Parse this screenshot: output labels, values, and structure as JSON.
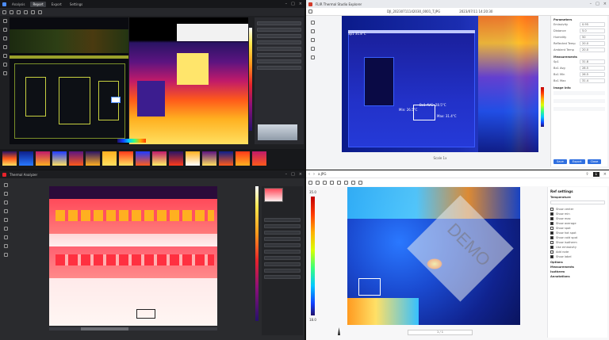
{
  "q1": {
    "tabs": [
      "Analysis",
      "Report",
      "Export",
      "Settings"
    ],
    "active_tab": 1,
    "colors": {
      "bg": "#1e1f22",
      "accent": "#4c8dff"
    }
  },
  "q2": {
    "toolbar_title": "FLIR Thermal Studio Explorer",
    "file_name": "DJI_20230711142030_0001_T.JPG",
    "timestamp": "2023/07/11 14:20:30",
    "labels": {
      "box_name": "Bx1",
      "avg": "Bx1 AVG: 28.5°C",
      "min": "Min: 26.5°C",
      "max": "Max: 31.4°C",
      "point": "Sp1 31.8°C"
    },
    "params_title": "Parameters",
    "params": [
      {
        "name": "Emissivity",
        "value": "0.95"
      },
      {
        "name": "Distance",
        "value": "5.0"
      },
      {
        "name": "Humidity",
        "value": "50"
      },
      {
        "name": "Reflected Temp",
        "value": "20.0"
      },
      {
        "name": "Ambient Temp",
        "value": "20.0"
      }
    ],
    "meas_title": "Measurements",
    "meas": [
      {
        "name": "Sp1",
        "value": "31.8"
      },
      {
        "name": "Bx1 Avg",
        "value": "28.5"
      },
      {
        "name": "Bx1 Min",
        "value": "26.5"
      },
      {
        "name": "Bx1 Max",
        "value": "31.4"
      }
    ],
    "info_title": "Image Info",
    "buttons": [
      "Save",
      "Export",
      "Close"
    ],
    "status": "Scale 1x"
  },
  "q3": {
    "title": "Thermal Analyzer",
    "colors": {
      "bg": "#2a2b2e"
    }
  },
  "q4": {
    "breadcrumb": "a.JPG",
    "panel_title": "Ref settings",
    "sections": [
      "Temperature",
      "Options",
      "Measurements",
      "Isotherm",
      "Annotations"
    ],
    "checks": [
      {
        "label": "Show center",
        "checked": false
      },
      {
        "label": "Show min",
        "checked": true
      },
      {
        "label": "Show max",
        "checked": true
      },
      {
        "label": "Show average",
        "checked": true
      },
      {
        "label": "Show spot",
        "checked": false
      },
      {
        "label": "Show hot spot",
        "checked": true
      },
      {
        "label": "Show cold spot",
        "checked": true
      },
      {
        "label": "Show isotherm",
        "checked": false
      },
      {
        "label": "Use emissivity",
        "checked": true
      },
      {
        "label": "Add note",
        "checked": false
      },
      {
        "label": "Show label",
        "checked": true
      }
    ],
    "watermark": "DEMO",
    "scale_max": "35.0",
    "scale_min": "18.0",
    "page_field": "1 / 1"
  }
}
